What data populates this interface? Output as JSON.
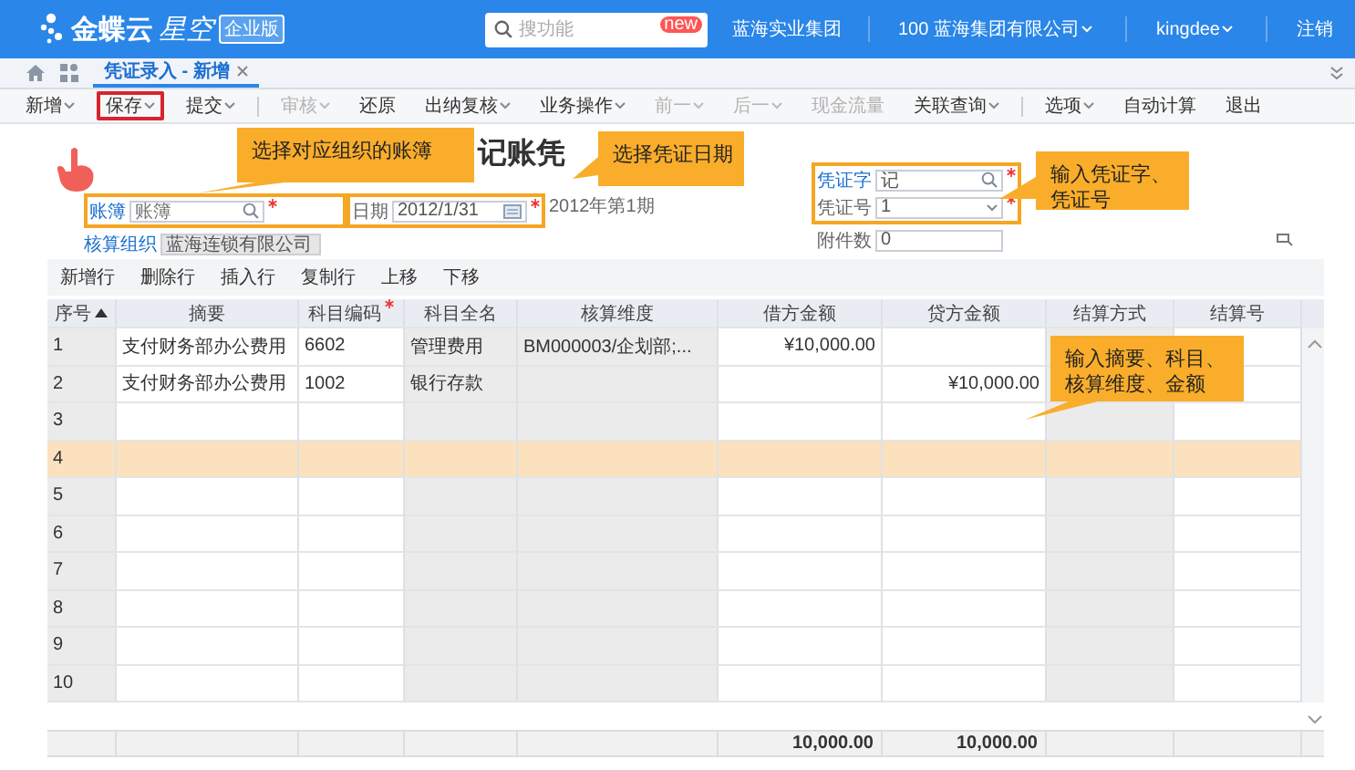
{
  "header": {
    "logo": "金蝶云",
    "logo_suffix": "星空",
    "edition": "企业版",
    "search": {
      "placeholder": "搜功能",
      "badge": "new"
    },
    "group": "蓝海实业集团",
    "org": "100 蓝海集团有限公司",
    "user": "kingdee",
    "logout": "注销"
  },
  "tabs": [
    {
      "label": "凭证录入 - 新增",
      "selected": true
    }
  ],
  "toolbar": [
    {
      "label": "新增",
      "menu": true,
      "disabled": false,
      "highlighted": false,
      "separator": false
    },
    {
      "label": "保存",
      "menu": true,
      "disabled": false,
      "highlighted": true,
      "separator": false
    },
    {
      "label": "提交",
      "menu": true,
      "disabled": false,
      "highlighted": false,
      "separator": true
    },
    {
      "label": "审核",
      "menu": true,
      "disabled": true,
      "highlighted": false,
      "separator": false
    },
    {
      "label": "还原",
      "menu": false,
      "disabled": false,
      "highlighted": false,
      "separator": false
    },
    {
      "label": "出纳复核",
      "menu": true,
      "disabled": false,
      "highlighted": false,
      "separator": false
    },
    {
      "label": "业务操作",
      "menu": true,
      "disabled": false,
      "highlighted": false,
      "separator": false
    },
    {
      "label": "前一",
      "menu": true,
      "disabled": true,
      "highlighted": false,
      "separator": false
    },
    {
      "label": "后一",
      "menu": true,
      "disabled": true,
      "highlighted": false,
      "separator": false
    },
    {
      "label": "现金流量",
      "menu": false,
      "disabled": true,
      "highlighted": false,
      "separator": false
    },
    {
      "label": "关联查询",
      "menu": true,
      "disabled": false,
      "highlighted": false,
      "separator": true
    },
    {
      "label": "选项",
      "menu": true,
      "disabled": false,
      "highlighted": false,
      "separator": false
    },
    {
      "label": "自动计算",
      "menu": false,
      "disabled": false,
      "highlighted": false,
      "separator": false
    },
    {
      "label": "退出",
      "menu": false,
      "disabled": false,
      "highlighted": false,
      "separator": false
    }
  ],
  "form": {
    "title": "记账凭",
    "ledger": {
      "label": "账簿",
      "placeholder": "账簿",
      "link": true,
      "required": true
    },
    "org": {
      "label": "核算组织",
      "value": "蓝海连锁有限公司",
      "link": true
    },
    "date": {
      "label": "日期",
      "value": "2012/1/31",
      "link": false,
      "required": true
    },
    "period": "2012年第1期",
    "voucher_word": {
      "label": "凭证字",
      "value": "记",
      "link": true,
      "required": true
    },
    "voucher_no": {
      "label": "凭证号",
      "value": "1",
      "link": false,
      "required": true
    },
    "attachments": {
      "label": "附件数",
      "value": "0",
      "link": false,
      "required": false
    }
  },
  "row_actions": [
    "新增行",
    "删除行",
    "插入行",
    "复制行",
    "上移",
    "下移"
  ],
  "table": {
    "columns": [
      {
        "label": "序号",
        "sorted": true,
        "required": false,
        "locked": true
      },
      {
        "label": "摘要",
        "sorted": false,
        "required": false,
        "locked": false
      },
      {
        "label": "科目编码",
        "sorted": false,
        "required": true,
        "locked": false
      },
      {
        "label": "科目全名",
        "sorted": false,
        "required": false,
        "locked": true
      },
      {
        "label": "核算维度",
        "sorted": false,
        "required": false,
        "locked": true
      },
      {
        "label": "借方金额",
        "sorted": false,
        "required": false,
        "locked": false
      },
      {
        "label": "贷方金额",
        "sorted": false,
        "required": false,
        "locked": false
      },
      {
        "label": "结算方式",
        "sorted": false,
        "required": false,
        "locked": true
      },
      {
        "label": "结算号",
        "sorted": false,
        "required": false,
        "locked": false
      }
    ],
    "rows": [
      {
        "no": "1",
        "summary": "支付财务部办公费用",
        "account_code": "6602",
        "account_name": "管理费用",
        "dimension": "BM000003/企划部;...",
        "debit": "¥10,000.00",
        "selected": false
      },
      {
        "no": "2",
        "summary": "支付财务部办公费用",
        "account_code": "1002",
        "account_name": "银行存款",
        "credit": "¥10,000.00",
        "selected": false
      },
      {
        "no": "3",
        "selected": false
      },
      {
        "no": "4",
        "selected": true
      },
      {
        "no": "5",
        "selected": false
      },
      {
        "no": "6",
        "selected": false
      },
      {
        "no": "7",
        "selected": false
      },
      {
        "no": "8",
        "selected": false
      },
      {
        "no": "9",
        "selected": false
      },
      {
        "no": "10",
        "selected": false
      }
    ],
    "totals": {
      "debit": "10,000.00",
      "credit": "10,000.00"
    }
  },
  "callouts": [
    "选择对应组织的账簿",
    "选择凭证日期",
    "输入凭证字、凭证号",
    "输入摘要、科目、核算维度、金额"
  ]
}
